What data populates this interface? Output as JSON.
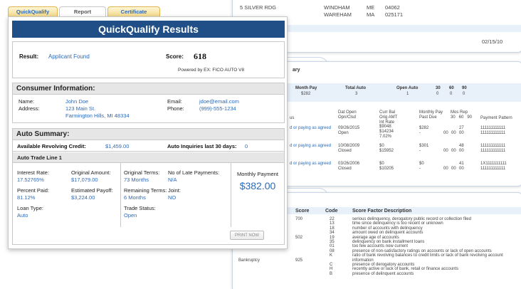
{
  "tabs": [
    {
      "label": "QuickQualify"
    },
    {
      "label": "Report"
    },
    {
      "label": "Certificate"
    }
  ],
  "title": "QuickQualify Results",
  "result": {
    "label": "Result:",
    "value": "Applicant Found"
  },
  "score": {
    "label": "Score:",
    "value": "618",
    "powered_by": "Powered by EX: FICO AUTO V8"
  },
  "consumer": {
    "heading": "Consumer Information:",
    "name_label": "Name:",
    "name": "John Doe",
    "address_label": "Address:",
    "address_line1": "123 Main St.",
    "address_line2": "Farmington Hills, MI 48334",
    "email_label": "Email:",
    "email": "jdoe@email.com",
    "phone_label": "Phone:",
    "phone": "(999)-555-1234"
  },
  "auto": {
    "heading": "Auto Summary:",
    "revolving_label": "Available Revolving Credit:",
    "revolving": "$1,459.00",
    "inquiries_label": "Auto Inquiries last 30 days:",
    "inquiries": "0",
    "trade_line_title": "Auto Trade Line 1",
    "interest_label": "Interest Rate:",
    "interest": "17.52765%",
    "original_amount_label": "Original Amount:",
    "original_amount": "$17,079.00",
    "percent_paid_label": "Percent Paid:",
    "percent_paid": "81.12%",
    "payoff_label": "Estimated Payoff:",
    "payoff": "$3,224.00",
    "loan_type_label": "Loan Type:",
    "loan_type": "Auto",
    "original_terms_label": "Original Terms:",
    "original_terms": "73 Months",
    "late_payments_label": "No of Late Payments:",
    "late_payments": "N/A",
    "remaining_terms_label": "Remaining Terms:",
    "remaining_terms": "6 Months",
    "joint_label": "Joint:",
    "joint": "NO",
    "trade_status_label": "Trade Status:",
    "trade_status": "Open",
    "monthly_payment_label": "Monthly Payment",
    "monthly_payment": "$382.00",
    "print_label": "PRINT NOW"
  },
  "bg_sheet1": {
    "row1": [
      "5 SILVER RDG",
      "WINDHAM",
      "ME",
      "04062"
    ],
    "row2": [
      "",
      "WAREHAM",
      "MA",
      "025171"
    ],
    "date": "02/15/10"
  },
  "bg_sheet2": {
    "tab_label": "ary",
    "headers": [
      "Month Pay",
      "Total Auto",
      "Open Auto",
      "30",
      "60",
      "90"
    ],
    "summary": [
      "$282",
      "3",
      "1",
      "0",
      "0",
      "0"
    ],
    "col_heads": {
      "status": "us",
      "date": "Dat Open\nOpn/Clsd",
      "bal": "Curr Bal\nOrig AMT\nInt Rate",
      "pay": "Monthly Pay\nPast Due",
      "mos": "Mos Rep\n30   60   90",
      "pattern": "Payment Pattern"
    },
    "rows": [
      {
        "status": "d or paying as agreed",
        "date": "09/26/2015\nOpen",
        "bal": "$9048\n$14234\n7.02%",
        "pay": "$282\n-",
        "m1": "27",
        "m2": "00",
        "m3": "00",
        "m4": "00",
        "pat": "111111111111\n111111111111"
      },
      {
        "status": "d or paying as agreed",
        "date": "10/08/2009\nClosed",
        "bal": "$0\n$15952",
        "pay": "$301\n-",
        "m1": "48",
        "m2": "00",
        "m3": "00",
        "m4": "00",
        "pat": "111111111111\n111111111111"
      },
      {
        "status": "d or paying as agreed",
        "date": "03/26/2006\nClosed",
        "bal": "$0\n$10205",
        "pay": "$0\n-",
        "m1": "41",
        "m2": "00",
        "m3": "00",
        "m4": "00",
        "pat": "1X1111111111\n111111111111"
      }
    ]
  },
  "bg_sheet3": {
    "headers": [
      "Score",
      "Code",
      "Score Factor Description"
    ],
    "score1": "700",
    "score2": "502",
    "bankruptcy_label": "Bankruptcy",
    "score3": "925",
    "factors": [
      {
        "code": "22",
        "desc": "serious delinquency, derogatory public record or collection filed"
      },
      {
        "code": "13",
        "desc": "time since delinquency is too recent or unknown"
      },
      {
        "code": "18",
        "desc": "number of accounts with delinquency"
      },
      {
        "code": "34",
        "desc": "amount owed on delinquent accounts"
      },
      {
        "code": "19",
        "desc": "average age of accounts"
      },
      {
        "code": "35",
        "desc": "delinquency on bank installment loans"
      },
      {
        "code": "01",
        "desc": "too few accounts now current"
      },
      {
        "code": "08",
        "desc": "presence of non-satisfactory ratings on accounts or lack of open accounts"
      },
      {
        "code": "K",
        "desc": "ratio of bank revolving balances to credit limits or lack of bank revolving account"
      },
      {
        "code": "",
        "desc": "information"
      },
      {
        "code": "C",
        "desc": "presence of derogatory accounts"
      },
      {
        "code": "H",
        "desc": "recently active or lack of bank, retail or finance accounts"
      },
      {
        "code": "B",
        "desc": "presence of delinquent accounts"
      }
    ]
  }
}
